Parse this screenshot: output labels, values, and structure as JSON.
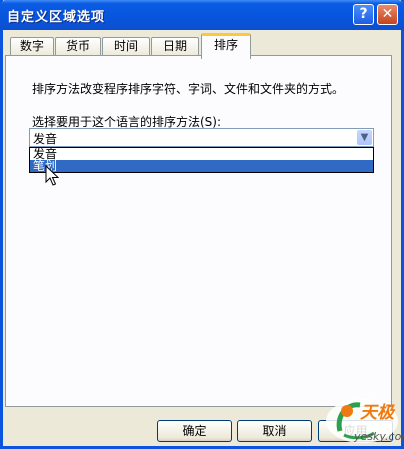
{
  "window": {
    "title": "自定义区域选项",
    "help_label": "?",
    "close_label": "✕"
  },
  "tabs": [
    {
      "label": "数字",
      "active": false
    },
    {
      "label": "货币",
      "active": false
    },
    {
      "label": "时间",
      "active": false
    },
    {
      "label": "日期",
      "active": false
    },
    {
      "label": "排序",
      "active": true
    }
  ],
  "panel": {
    "description": "排序方法改变程序排序字符、字词、文件和文件夹的方式。",
    "sort_label": "选择要用于这个语言的排序方法(S):",
    "sort_value": "发音",
    "sort_options": [
      "发音",
      "笔划"
    ],
    "highlighted_option": "笔划"
  },
  "buttons": {
    "ok": "确定",
    "cancel": "取消",
    "apply": "应用"
  },
  "watermark": {
    "name": "天极",
    "url": "yesky.com"
  },
  "colors": {
    "title_bar": "#0a5be4",
    "dialog_bg": "#ece9d8",
    "selection": "#316ac5",
    "tab_accent": "#ffc83c"
  }
}
